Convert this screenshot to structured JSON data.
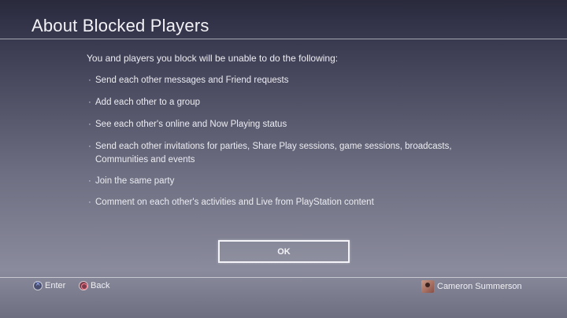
{
  "header": {
    "title": "About Blocked Players"
  },
  "main": {
    "intro": "You and players you block will be unable to do the following:",
    "bullet_char": "·",
    "items": [
      {
        "text": "Send each other messages and Friend requests"
      },
      {
        "text": "Add each other to a group"
      },
      {
        "text": "See each other's online and Now Playing status"
      },
      {
        "text": "Send each other invitations for parties, Share Play sessions, game sessions, broadcasts, Communities and events"
      },
      {
        "text": "Join the same party"
      },
      {
        "text": "Comment on each other's activities and Live from PlayStation content"
      }
    ],
    "ok_label": "OK"
  },
  "footer": {
    "enter_label": "Enter",
    "back_label": "Back",
    "user_name": "Cameron Summerson",
    "enter_icon": "cross-button-icon",
    "back_icon": "circle-button-icon"
  },
  "colors": {
    "accent": "#f4f4f8",
    "cross": "#9db3ff",
    "circle": "#ff7f8f"
  }
}
